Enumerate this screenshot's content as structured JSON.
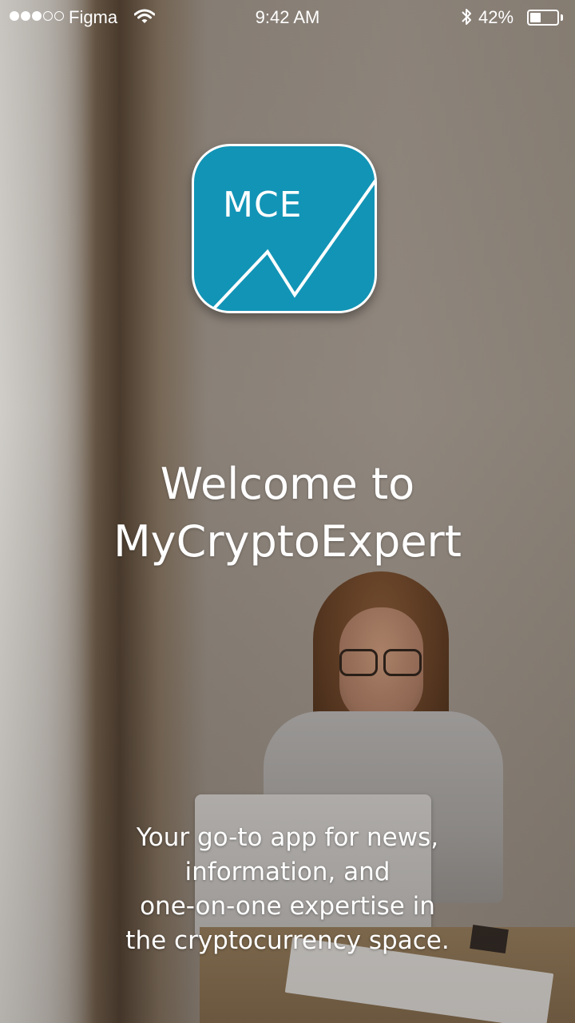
{
  "status_bar": {
    "carrier": "Figma",
    "time": "9:42 AM",
    "battery_percent": "42%",
    "battery_level": 0.42,
    "signal_bars_filled": 3,
    "signal_bars_total": 5,
    "icons": [
      "signal-dots-icon",
      "wifi-icon",
      "bluetooth-icon",
      "battery-icon"
    ]
  },
  "logo": {
    "text": "MCE",
    "background_color": "#1294b6",
    "border_color": "#ffffff"
  },
  "welcome": {
    "line1": "Welcome to",
    "line2": "MyCryptoExpert"
  },
  "tagline": {
    "line1": "Your go-to app for news,",
    "line2": "information, and",
    "line3": "one-on-one expertise in",
    "line4": "the cryptocurrency space."
  }
}
